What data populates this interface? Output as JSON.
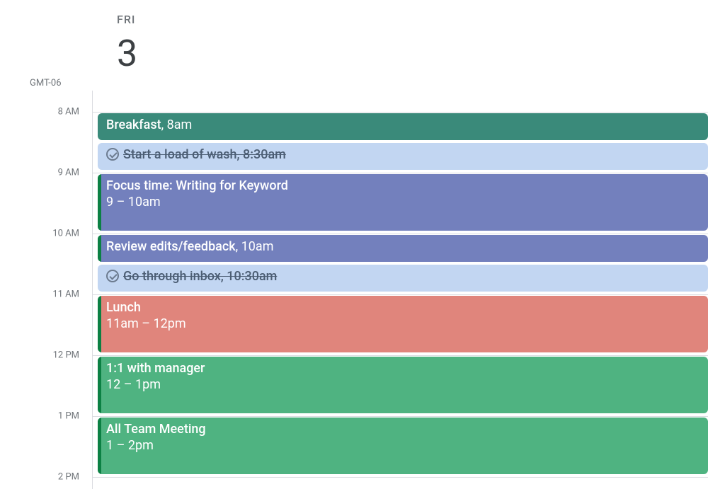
{
  "header": {
    "day_name": "FRI",
    "day_number": "3",
    "timezone": "GMT-06"
  },
  "hours": [
    {
      "label": "8 AM"
    },
    {
      "label": "9 AM"
    },
    {
      "label": "10 AM"
    },
    {
      "label": "11 AM"
    },
    {
      "label": "12 PM"
    },
    {
      "label": "1 PM"
    },
    {
      "label": "2 PM"
    }
  ],
  "events": {
    "breakfast": {
      "title": "Breakfast",
      "time": ", 8am"
    },
    "wash": {
      "title": "Start a load of wash, 8:30am"
    },
    "focus": {
      "title": "Focus time: Writing for Keyword",
      "time": "9 – 10am"
    },
    "review": {
      "title": "Review edits/feedback",
      "time": ", 10am"
    },
    "inbox": {
      "title": "Go through inbox, 10:30am"
    },
    "lunch": {
      "title": "Lunch",
      "time": "11am – 12pm"
    },
    "manager": {
      "title": "1:1 with manager",
      "time": "12 – 1pm"
    },
    "team": {
      "title": "All Team Meeting",
      "time": "1 – 2pm"
    }
  }
}
